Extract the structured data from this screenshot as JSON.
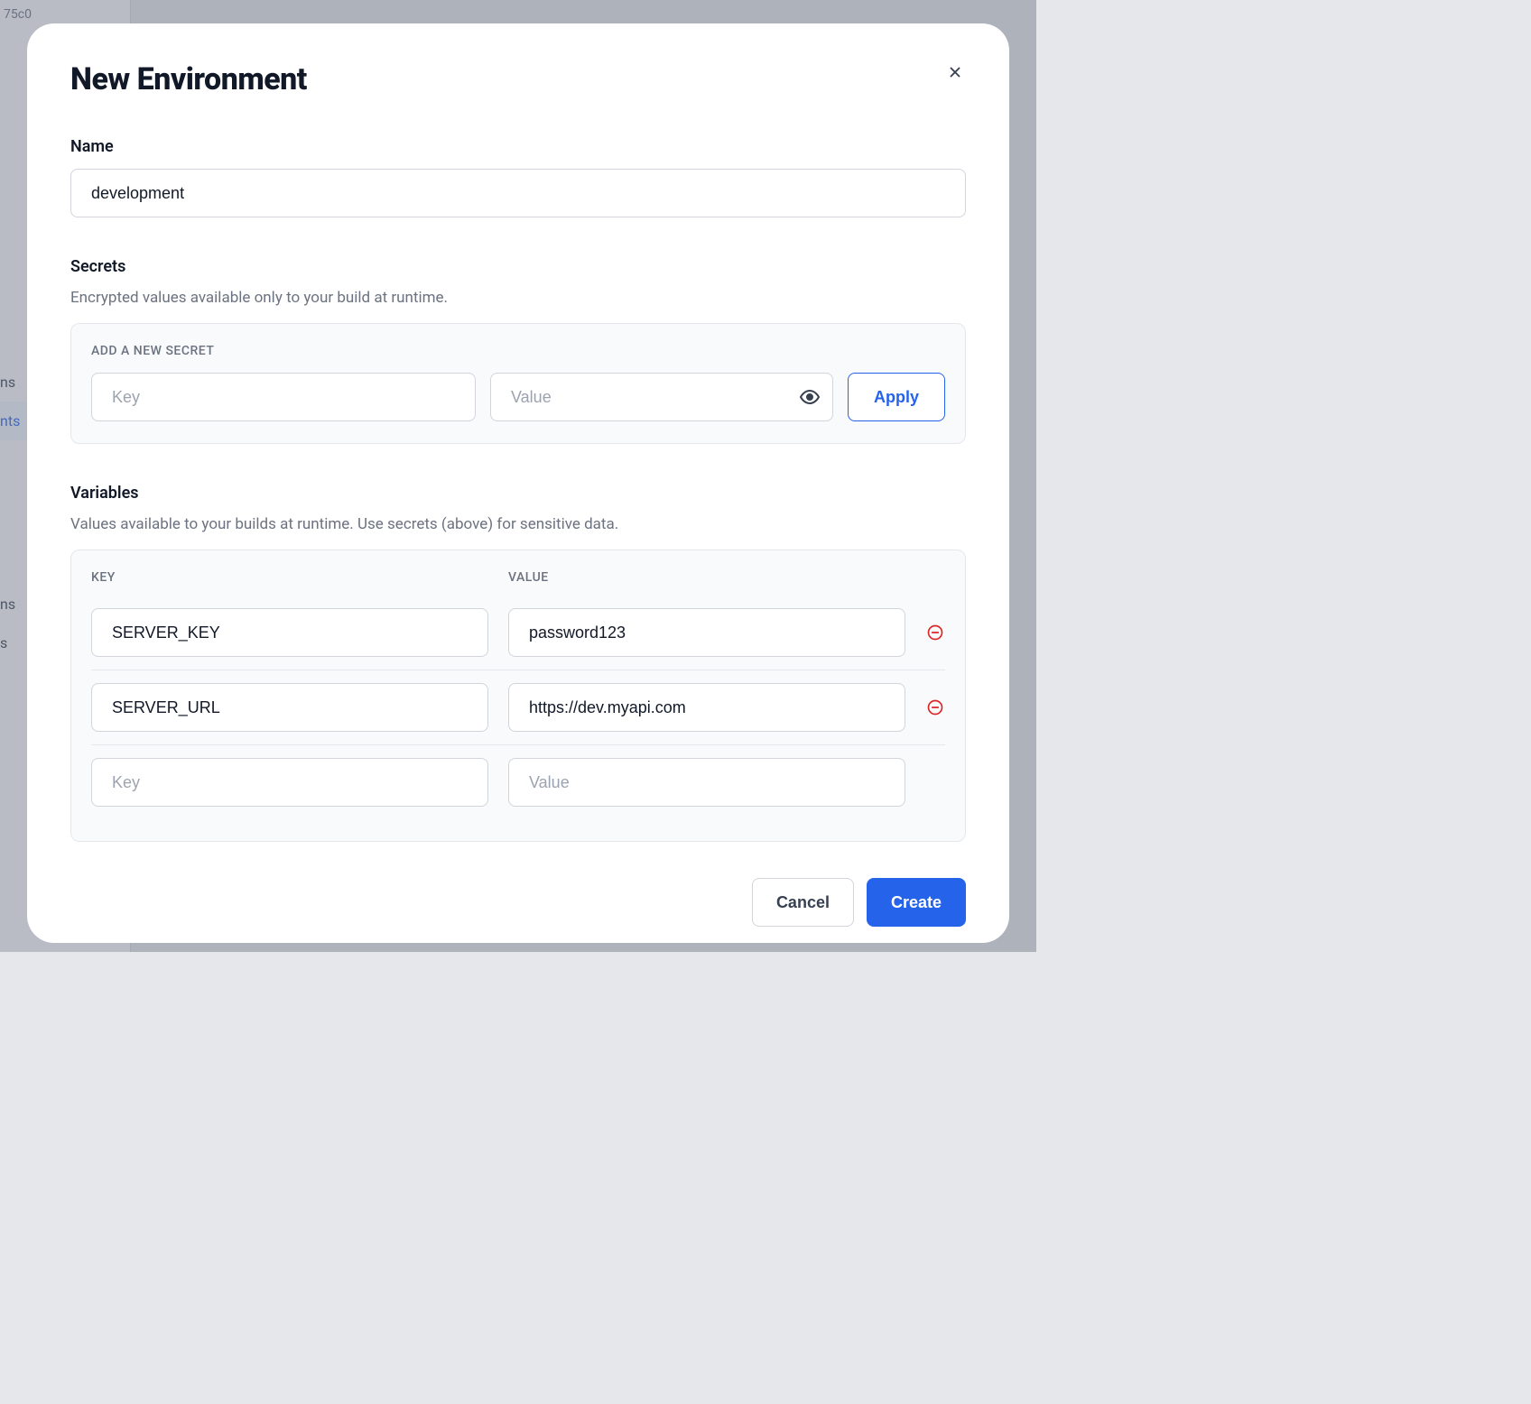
{
  "background": {
    "fragment": "75c0",
    "sidebar_items": [
      {
        "label": "ns",
        "active": false
      },
      {
        "label": "nts",
        "active": true
      },
      {
        "label": "ns",
        "active": false
      },
      {
        "label": "s",
        "active": false
      }
    ]
  },
  "modal": {
    "title": "New Environment",
    "name_section": {
      "label": "Name",
      "value": "development"
    },
    "secrets_section": {
      "label": "Secrets",
      "description": "Encrypted values available only to your build at runtime.",
      "panel_title": "ADD A NEW SECRET",
      "key_placeholder": "Key",
      "value_placeholder": "Value",
      "apply_label": "Apply"
    },
    "variables_section": {
      "label": "Variables",
      "description": "Values available to your builds at runtime. Use secrets (above) for sensitive data.",
      "header_key": "KEY",
      "header_value": "VALUE",
      "rows": [
        {
          "key": "SERVER_KEY",
          "value": "password123"
        },
        {
          "key": "SERVER_URL",
          "value": "https://dev.myapi.com"
        }
      ],
      "empty_key_placeholder": "Key",
      "empty_value_placeholder": "Value"
    },
    "footer": {
      "cancel": "Cancel",
      "create": "Create"
    }
  }
}
